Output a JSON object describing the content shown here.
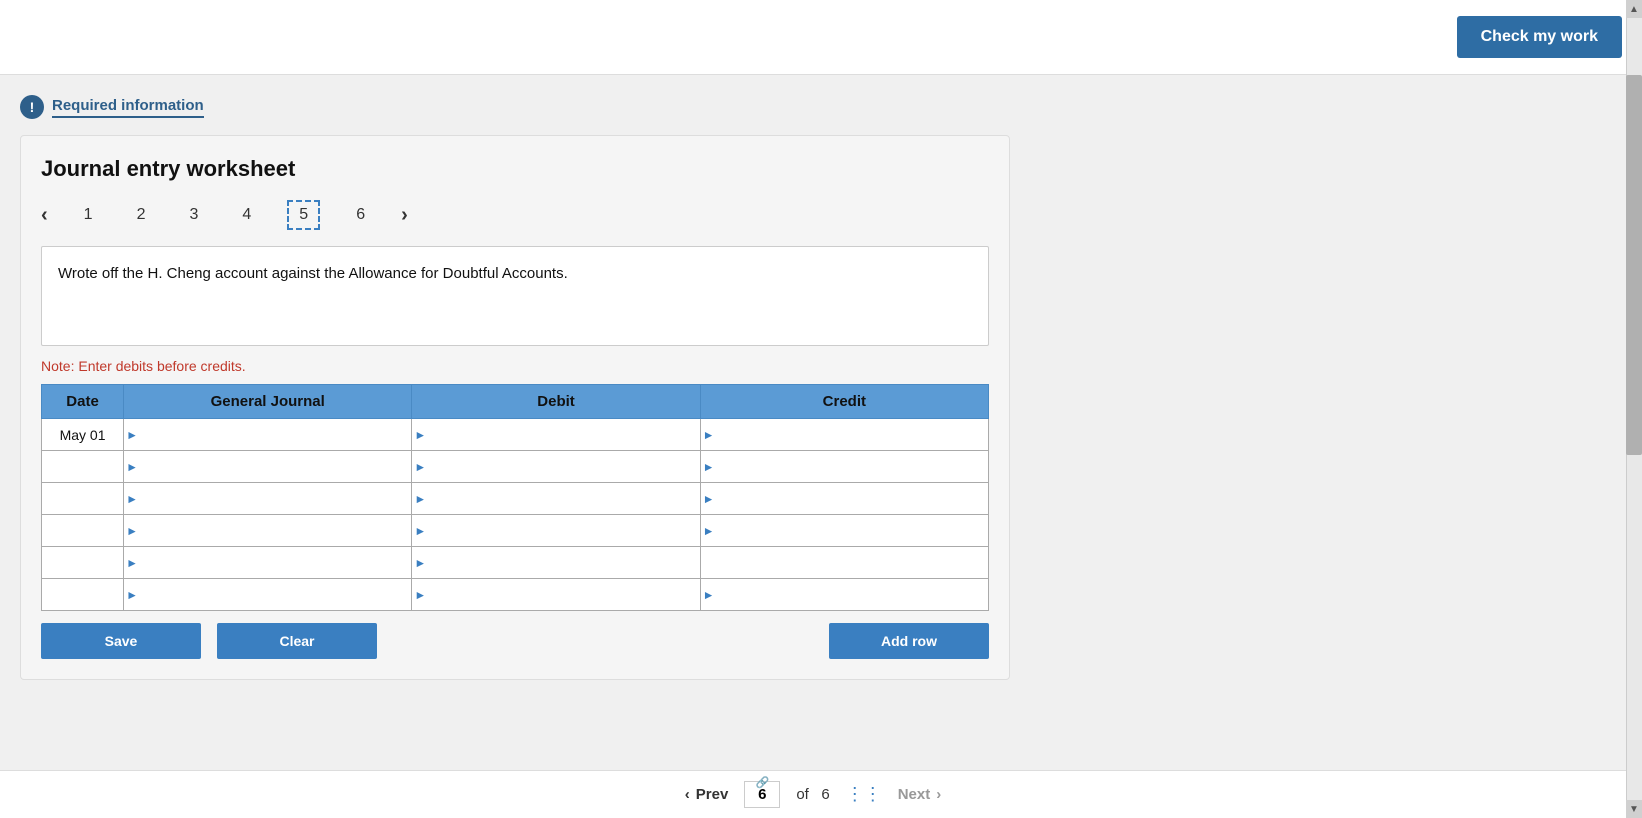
{
  "header": {
    "check_button_label": "Check my work"
  },
  "required_info": {
    "icon": "!",
    "label": "Required information"
  },
  "worksheet": {
    "title": "Journal entry worksheet",
    "pages": [
      "1",
      "2",
      "3",
      "4",
      "5",
      "6"
    ],
    "active_page": "5",
    "description": "Wrote off the H. Cheng account against the Allowance for Doubtful Accounts.",
    "note": "Note: Enter debits before credits.",
    "table": {
      "headers": [
        "Date",
        "General Journal",
        "Debit",
        "Credit"
      ],
      "rows": [
        {
          "date": "May 01",
          "journal": "",
          "debit": "",
          "credit": ""
        },
        {
          "date": "",
          "journal": "",
          "debit": "",
          "credit": ""
        },
        {
          "date": "",
          "journal": "",
          "debit": "",
          "credit": ""
        },
        {
          "date": "",
          "journal": "",
          "debit": "",
          "credit": ""
        },
        {
          "date": "",
          "journal": "",
          "debit": "",
          "credit": ""
        },
        {
          "date": "",
          "journal": "",
          "debit": "",
          "credit": ""
        }
      ]
    }
  },
  "footer": {
    "prev_label": "Prev",
    "next_label": "Next",
    "current_page": "6",
    "total_pages": "6",
    "of_text": "of"
  },
  "scrollbar": {
    "up_arrow": "▲",
    "down_arrow": "▼"
  }
}
